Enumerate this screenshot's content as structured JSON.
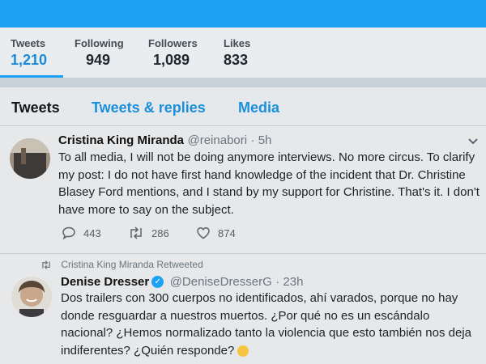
{
  "colors": {
    "accent": "#1da1f2",
    "link": "#1b8fdc"
  },
  "stats": [
    {
      "label": "Tweets",
      "value": "1,210"
    },
    {
      "label": "Following",
      "value": "949"
    },
    {
      "label": "Followers",
      "value": "1,089"
    },
    {
      "label": "Likes",
      "value": "833"
    }
  ],
  "tabs": [
    {
      "label": "Tweets"
    },
    {
      "label": "Tweets & replies"
    },
    {
      "label": "Media"
    }
  ],
  "tweets": [
    {
      "name": "Cristina King Miranda",
      "handle": "@reinabori",
      "time": "· 5h",
      "text": "To all media, I will not be doing anymore interviews. No more circus. To clarify my post: I do not have first hand knowledge of the incident that Dr. Christine Blasey Ford mentions, and I stand by my support for Christine. That's it. I don't have more to say on the subject.",
      "replies": "443",
      "retweets": "286",
      "likes": "874",
      "avatar_icon": "profile-photo"
    },
    {
      "retweeted_by": "Cristina King Miranda Retweeted",
      "name": "Denise Dresser",
      "handle": "@DeniseDresserG",
      "time": "· 23h",
      "text": "Dos trailers con 300 cuerpos no identificados, ahí varados, porque no hay donde resguardar a nuestros muertos. ¿Por qué no es un escándalo nacional? ¿Hemos normalizado tanto la violencia que esto también nos deja indiferentes? ¿Quién responde?",
      "verified_icon": "verified-badge",
      "avatar_icon": "profile-photo"
    }
  ]
}
